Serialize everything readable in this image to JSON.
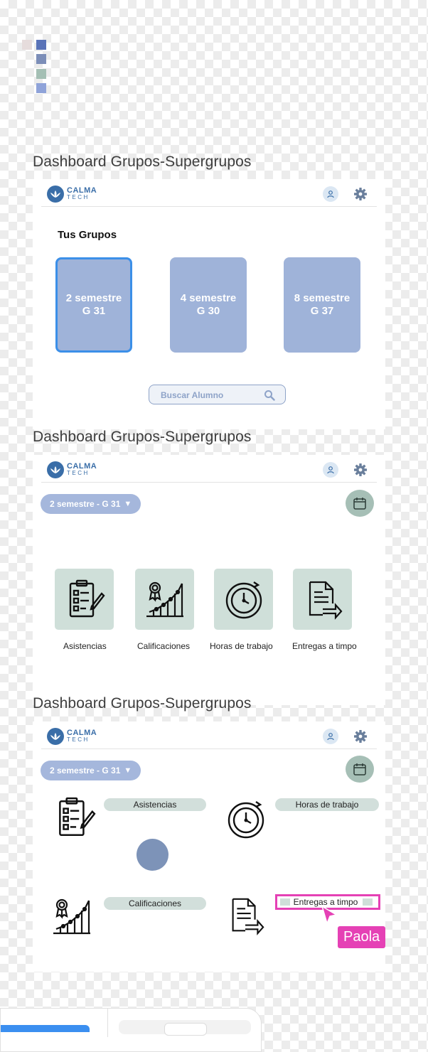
{
  "palette": [
    "#e6dcdc",
    "#5a73b8",
    "#7c8eb8",
    "#a4bfb4",
    "#8fa3d9"
  ],
  "frames": [
    {
      "title": "Dashboard Grupos-Supergrupos",
      "logo": {
        "line1": "CALMA",
        "line2": "TECH"
      },
      "heading": "Tus Grupos",
      "groups": [
        {
          "line1": "2 semestre",
          "line2": "G 31",
          "selected": true
        },
        {
          "line1": "4 semestre",
          "line2": "G 30",
          "selected": false
        },
        {
          "line1": "8 semestre",
          "line2": "G 37",
          "selected": false
        }
      ],
      "search": {
        "placeholder": "Buscar Alumno",
        "icon": "search-icon"
      }
    },
    {
      "title": "Dashboard Grupos-Supergrupos",
      "logo": {
        "line1": "CALMA",
        "line2": "TECH"
      },
      "dropdown": {
        "label": "2 semestre - G 31",
        "arrow": "▼"
      },
      "calendar_icon": "calendar-icon",
      "metrics": [
        {
          "label": "Asistencias",
          "icon": "checklist-icon"
        },
        {
          "label": "Calificaciones",
          "icon": "award-growth-icon"
        },
        {
          "label": "Horas de trabajo",
          "icon": "clock-icon"
        },
        {
          "label": "Entregas a timpo",
          "icon": "document-send-icon"
        }
      ]
    },
    {
      "title": "Dashboard Grupos-Supergrupos",
      "logo": {
        "line1": "CALMA",
        "line2": "TECH"
      },
      "dropdown": {
        "label": "2 semestre - G 31",
        "arrow": "▼"
      },
      "calendar_icon": "calendar-icon",
      "items": [
        {
          "label": "Asistencias",
          "icon": "checklist-icon"
        },
        {
          "label": "Horas de trabajo",
          "icon": "clock-icon"
        },
        {
          "label": "Calificaciones",
          "icon": "award-growth-icon"
        },
        {
          "label": "Entregas a timpo",
          "icon": "document-send-icon"
        }
      ]
    }
  ],
  "collaborator": {
    "name": "Paola",
    "color": "#e541b5"
  }
}
